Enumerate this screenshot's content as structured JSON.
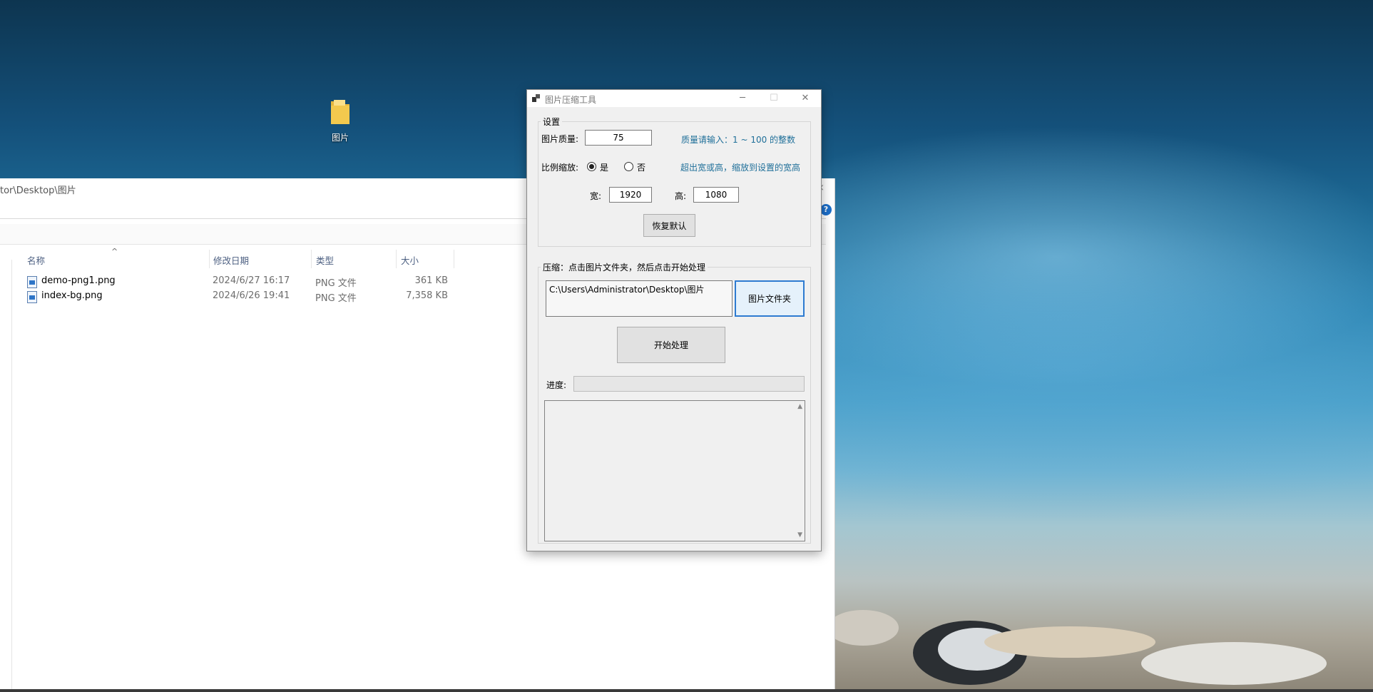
{
  "desktop": {
    "icon_label": "图片"
  },
  "explorer": {
    "address_path": "tor\\Desktop\\图片",
    "help_glyph": "?",
    "close_glyph": "×",
    "sort_caret": "^",
    "columns": {
      "name": "名称",
      "modified": "修改日期",
      "type": "类型",
      "size": "大小"
    },
    "files": [
      {
        "name": "demo-png1.png",
        "modified": "2024/6/27 16:17",
        "type": "PNG 文件",
        "size": "361 KB"
      },
      {
        "name": "index-bg.png",
        "modified": "2024/6/26 19:41",
        "type": "PNG 文件",
        "size": "7,358 KB"
      }
    ]
  },
  "dialog": {
    "title": "图片压缩工具",
    "settings": {
      "group_title": "设置",
      "quality_label": "图片质量:",
      "quality_value": "75",
      "quality_hint": "质量请输入：1 ~ 100 的整数",
      "scale_label": "比例缩放:",
      "scale_yes": "是",
      "scale_no": "否",
      "scale_hint": "超出宽或高，缩放到设置的宽高",
      "width_label": "宽:",
      "width_value": "1920",
      "height_label": "高:",
      "height_value": "1080",
      "reset_label": "恢复默认"
    },
    "compress": {
      "group_title": "压缩：点击图片文件夹，然后点击开始处理",
      "folder_path": "C:\\Users\\Administrator\\Desktop\\图片",
      "folder_button": "图片文件夹",
      "start_button": "开始处理",
      "progress_label": "进度:",
      "progress_value": 0
    }
  }
}
